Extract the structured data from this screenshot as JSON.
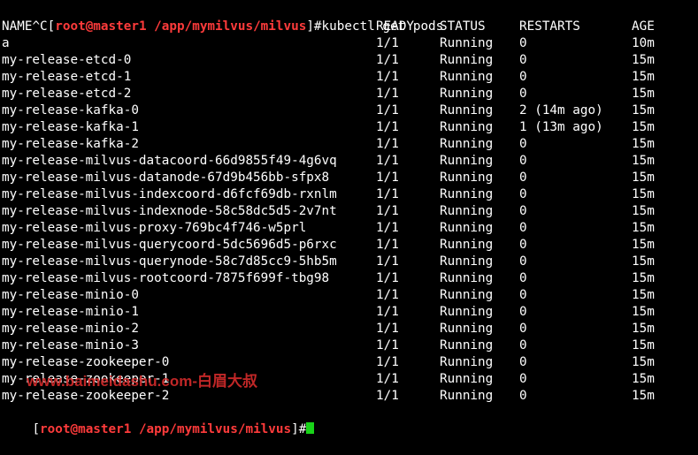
{
  "prompt": {
    "prefix": "^C[",
    "userhost": "root@master1",
    "path": "/app/mymilvus/milvus",
    "suffix": "]#",
    "command": "kubectl get pods"
  },
  "headers": {
    "name": "NAME",
    "ready": "READY",
    "status": "STATUS",
    "restarts": "RESTARTS",
    "age": "AGE"
  },
  "rows": [
    {
      "name": "a",
      "ready": "1/1",
      "status": "Running",
      "restarts": "0",
      "age": "10m"
    },
    {
      "name": "my-release-etcd-0",
      "ready": "1/1",
      "status": "Running",
      "restarts": "0",
      "age": "15m"
    },
    {
      "name": "my-release-etcd-1",
      "ready": "1/1",
      "status": "Running",
      "restarts": "0",
      "age": "15m"
    },
    {
      "name": "my-release-etcd-2",
      "ready": "1/1",
      "status": "Running",
      "restarts": "0",
      "age": "15m"
    },
    {
      "name": "my-release-kafka-0",
      "ready": "1/1",
      "status": "Running",
      "restarts": "2 (14m ago)",
      "age": "15m"
    },
    {
      "name": "my-release-kafka-1",
      "ready": "1/1",
      "status": "Running",
      "restarts": "1 (13m ago)",
      "age": "15m"
    },
    {
      "name": "my-release-kafka-2",
      "ready": "1/1",
      "status": "Running",
      "restarts": "0",
      "age": "15m"
    },
    {
      "name": "my-release-milvus-datacoord-66d9855f49-4g6vq",
      "ready": "1/1",
      "status": "Running",
      "restarts": "0",
      "age": "15m"
    },
    {
      "name": "my-release-milvus-datanode-67d9b456bb-sfpx8",
      "ready": "1/1",
      "status": "Running",
      "restarts": "0",
      "age": "15m"
    },
    {
      "name": "my-release-milvus-indexcoord-d6fcf69db-rxnlm",
      "ready": "1/1",
      "status": "Running",
      "restarts": "0",
      "age": "15m"
    },
    {
      "name": "my-release-milvus-indexnode-58c58dc5d5-2v7nt",
      "ready": "1/1",
      "status": "Running",
      "restarts": "0",
      "age": "15m"
    },
    {
      "name": "my-release-milvus-proxy-769bc4f746-w5prl",
      "ready": "1/1",
      "status": "Running",
      "restarts": "0",
      "age": "15m"
    },
    {
      "name": "my-release-milvus-querycoord-5dc5696d5-p6rxc",
      "ready": "1/1",
      "status": "Running",
      "restarts": "0",
      "age": "15m"
    },
    {
      "name": "my-release-milvus-querynode-58c7d85cc9-5hb5m",
      "ready": "1/1",
      "status": "Running",
      "restarts": "0",
      "age": "15m"
    },
    {
      "name": "my-release-milvus-rootcoord-7875f699f-tbg98",
      "ready": "1/1",
      "status": "Running",
      "restarts": "0",
      "age": "15m"
    },
    {
      "name": "my-release-minio-0",
      "ready": "1/1",
      "status": "Running",
      "restarts": "0",
      "age": "15m"
    },
    {
      "name": "my-release-minio-1",
      "ready": "1/1",
      "status": "Running",
      "restarts": "0",
      "age": "15m"
    },
    {
      "name": "my-release-minio-2",
      "ready": "1/1",
      "status": "Running",
      "restarts": "0",
      "age": "15m"
    },
    {
      "name": "my-release-minio-3",
      "ready": "1/1",
      "status": "Running",
      "restarts": "0",
      "age": "15m"
    },
    {
      "name": "my-release-zookeeper-0",
      "ready": "1/1",
      "status": "Running",
      "restarts": "0",
      "age": "15m"
    },
    {
      "name": "my-release-zookeeper-1",
      "ready": "1/1",
      "status": "Running",
      "restarts": "0",
      "age": "15m"
    },
    {
      "name": "my-release-zookeeper-2",
      "ready": "1/1",
      "status": "Running",
      "restarts": "0",
      "age": "15m"
    }
  ],
  "final_prompt": {
    "prefix": "[",
    "userhost": "root@master1",
    "path": "/app/mymilvus/milvus",
    "suffix": "]#"
  },
  "watermark": "www.baimeidashu.com-白眉大叔",
  "colors": {
    "background": "#000000",
    "text": "#ffffff",
    "prompt_accent": "#ff3b3b",
    "cursor": "#19d319",
    "watermark": "#d12b2b"
  }
}
